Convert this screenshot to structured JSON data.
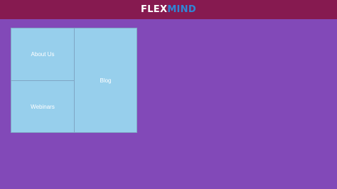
{
  "colors": {
    "header_background": "#861a50",
    "page_background": "#8249b8",
    "tile_background": "#97cfec",
    "logo_primary": "#ffffff",
    "logo_accent": "#2f86d6"
  },
  "header": {
    "logo_part_1": "FLEX",
    "logo_part_2": "MIND"
  },
  "tiles": [
    {
      "label": "About Us"
    },
    {
      "label": "Webinars"
    },
    {
      "label": "Blog"
    }
  ]
}
